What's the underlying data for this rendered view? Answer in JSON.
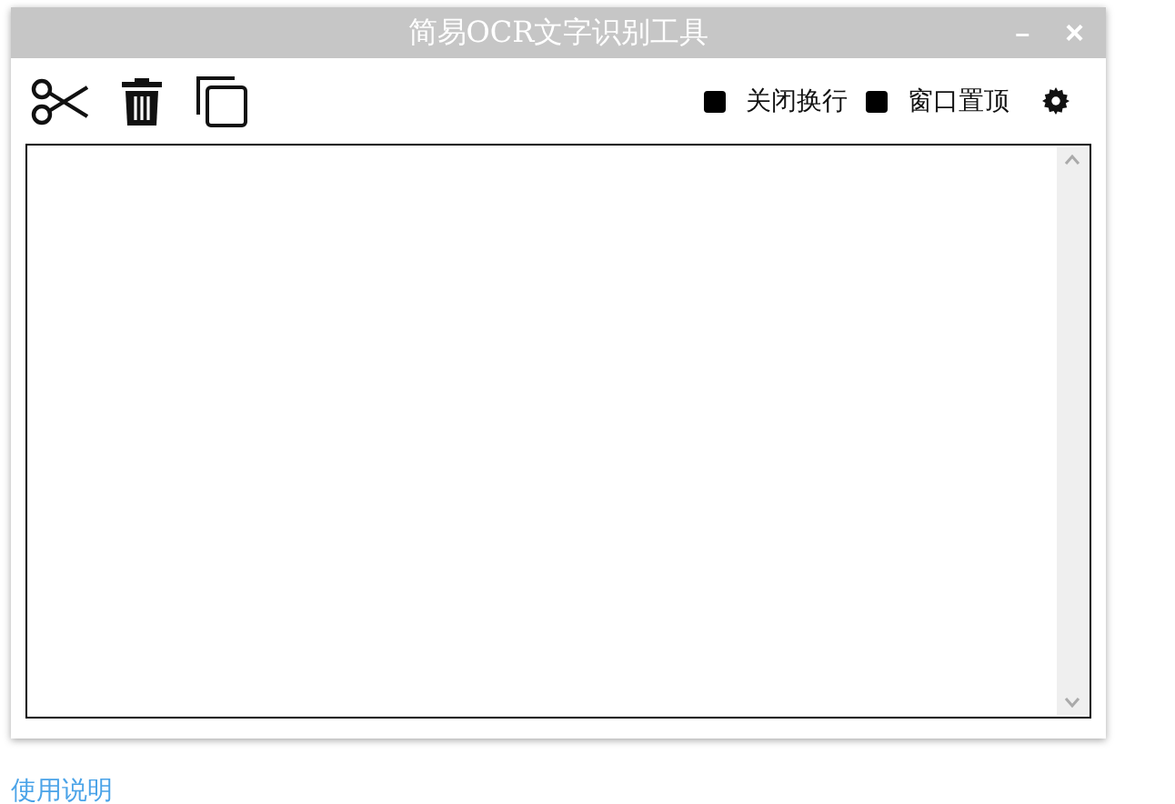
{
  "window": {
    "title": "简易OCR文字识别工具",
    "minimize": "–",
    "close": "×"
  },
  "toolbar": {
    "options": [
      {
        "label": "关闭换行",
        "checked": false
      },
      {
        "label": "窗口置顶",
        "checked": false
      }
    ]
  },
  "help_link": "使用说明"
}
